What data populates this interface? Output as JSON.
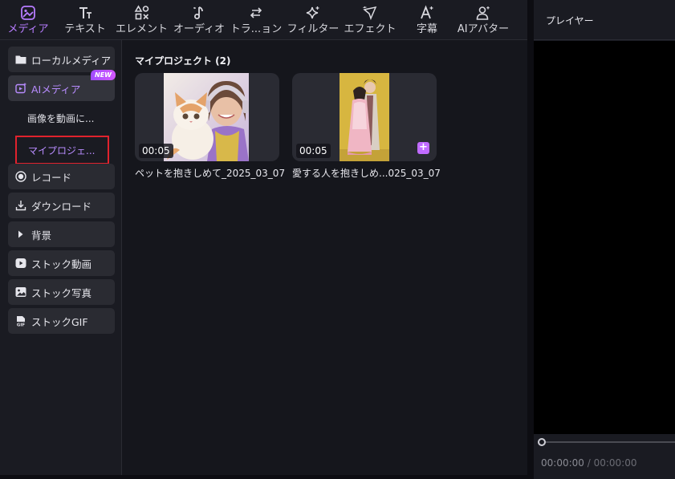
{
  "toolbar": {
    "tabs": [
      {
        "label": "メディア",
        "icon": "media-icon",
        "active": true
      },
      {
        "label": "テキスト",
        "icon": "text-icon"
      },
      {
        "label": "エレメント",
        "icon": "elements-icon"
      },
      {
        "label": "オーディオ",
        "icon": "music-note-icon"
      },
      {
        "label": "トラ...ョン",
        "icon": "transition-arrows-icon"
      },
      {
        "label": "フィルター",
        "icon": "sparkle-icon"
      },
      {
        "label": "エフェクト",
        "icon": "effect-icon"
      },
      {
        "label": "字幕",
        "icon": "subtitle-a-icon"
      },
      {
        "label": "AIアバター",
        "icon": "avatar-icon"
      }
    ]
  },
  "sidebar": {
    "items": [
      {
        "label": "ローカルメディア",
        "icon": "folder-icon"
      },
      {
        "label": "AIメディア",
        "icon": "ai-media-icon",
        "badge": "NEW"
      },
      {
        "label": "レコード",
        "icon": "record-icon"
      },
      {
        "label": "ダウンロード",
        "icon": "download-icon"
      },
      {
        "label": "背景",
        "icon": "triangle-right-icon"
      },
      {
        "label": "ストック動画",
        "icon": "play-icon"
      },
      {
        "label": "ストック写真",
        "icon": "photo-icon"
      },
      {
        "label": "ストックGIF",
        "icon": "gif-icon"
      }
    ],
    "sub_items": [
      {
        "label": "画像を動画に..."
      },
      {
        "label": "マイプロジェ...",
        "selected": true
      }
    ]
  },
  "main": {
    "section_title": "マイプロジェクト (2)",
    "projects": [
      {
        "title": "ペットを抱きしめて_2025_03_07",
        "duration": "00:05"
      },
      {
        "title": "愛する人を抱きしめ...025_03_07",
        "duration": "00:05"
      }
    ]
  },
  "player": {
    "title": "プレイヤー",
    "current_time": "00:00:00",
    "separator": " / ",
    "total_time": "00:00:00"
  },
  "colors": {
    "accent": "#b77cff",
    "highlight_border": "#e0222d",
    "panel": "#1a1b22",
    "content": "#15161c"
  }
}
